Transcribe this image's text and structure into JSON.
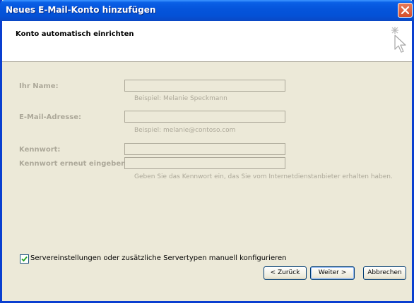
{
  "window": {
    "title": "Neues E-Mail-Konto hinzufügen"
  },
  "header": {
    "title": "Konto automatisch einrichten"
  },
  "form": {
    "name_label": "Ihr Name:",
    "name_hint": "Beispiel: Melanie Speckmann",
    "email_label": "E-Mail-Adresse:",
    "email_hint": "Beispiel: melanie@contoso.com",
    "password_label": "Kennwort:",
    "password_repeat_label": "Kennwort erneut eingeben:",
    "password_hint": "Geben Sie das Kennwort ein, das Sie vom Internetdienstanbieter erhalten haben."
  },
  "manual_config": {
    "label": "Servereinstellungen oder zusätzliche Servertypen manuell konfigurieren",
    "checked": true
  },
  "buttons": {
    "back": "< Zurück",
    "next": "Weiter >",
    "cancel": "Abbrechen"
  },
  "icons": {
    "close": "close-icon",
    "cursor": "cursor-sparkle-icon",
    "check": "checkmark-icon"
  },
  "colors": {
    "titlebar": "#0555dc",
    "disabled_text": "#aca899",
    "background": "#ece9d8"
  }
}
